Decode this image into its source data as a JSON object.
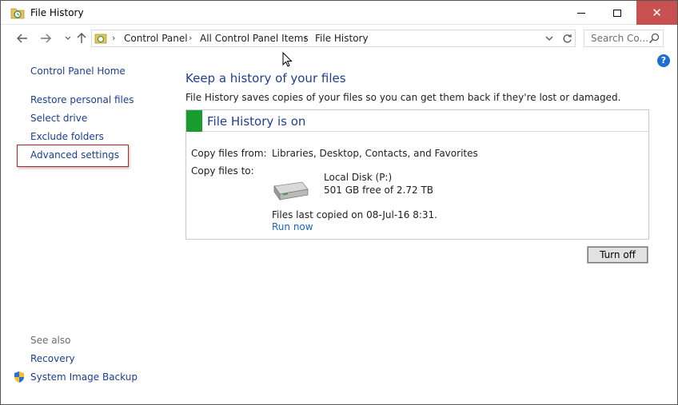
{
  "window": {
    "title": "File History",
    "icon": "file-history-icon"
  },
  "nav": {
    "back_icon": "arrow-left-icon",
    "forward_icon": "arrow-right-icon",
    "up_icon": "arrow-up-icon",
    "breadcrumbs": [
      "Control Panel",
      "All Control Panel Items",
      "File History"
    ],
    "search_placeholder": "Search Co..."
  },
  "sidebar": {
    "home": "Control Panel Home",
    "links": [
      "Restore personal files",
      "Select drive",
      "Exclude folders",
      "Advanced settings"
    ],
    "see_also_label": "See also",
    "see_also": [
      "Recovery",
      "System Image Backup"
    ]
  },
  "main": {
    "title": "Keep a history of your files",
    "description": "File History saves copies of your files so you can get them back if they're lost or damaged.",
    "status": {
      "title": "File History is on",
      "color": "#1a9b2f",
      "copy_from_label": "Copy files from:",
      "copy_from_value": "Libraries, Desktop, Contacts, and Favorites",
      "copy_to_label": "Copy files to:",
      "drive_name": "Local Disk (P:)",
      "drive_free": "501 GB free of 2.72 TB",
      "last_copied": "Files last copied on 08-Jul-16 8:31.",
      "run_now": "Run now"
    },
    "turn_off_button": "Turn off"
  },
  "colors": {
    "link": "#1a3f8f",
    "heading": "#1e3f8f",
    "close_button": "#c75050",
    "highlight": "#b0262a"
  }
}
